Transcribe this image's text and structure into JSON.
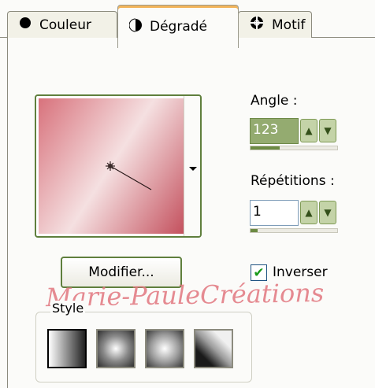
{
  "tabs": [
    {
      "label": "Couleur",
      "icon": "solid-circle-icon"
    },
    {
      "label": "Dégradé",
      "icon": "half-circle-icon",
      "selected": true
    },
    {
      "label": "Motif",
      "icon": "pattern-ball-icon"
    }
  ],
  "gradient": {
    "angle_deg": 123,
    "colors": [
      "#d8727c",
      "#f5e0e1",
      "#c4515e"
    ]
  },
  "angle": {
    "label": "Angle :",
    "value": "123",
    "level": 0.34
  },
  "repetitions": {
    "label": "Répétitions :",
    "value": "1",
    "level": 0.0
  },
  "modify_button": "Modifier...",
  "invert": {
    "label": "Inverser",
    "checked": true
  },
  "watermark": "Marie-PauleCréations",
  "style_group": {
    "title": "Style",
    "options": [
      "linear",
      "rectangular",
      "radial",
      "angular"
    ],
    "selected": "linear"
  },
  "accent": "#5f7f3d"
}
